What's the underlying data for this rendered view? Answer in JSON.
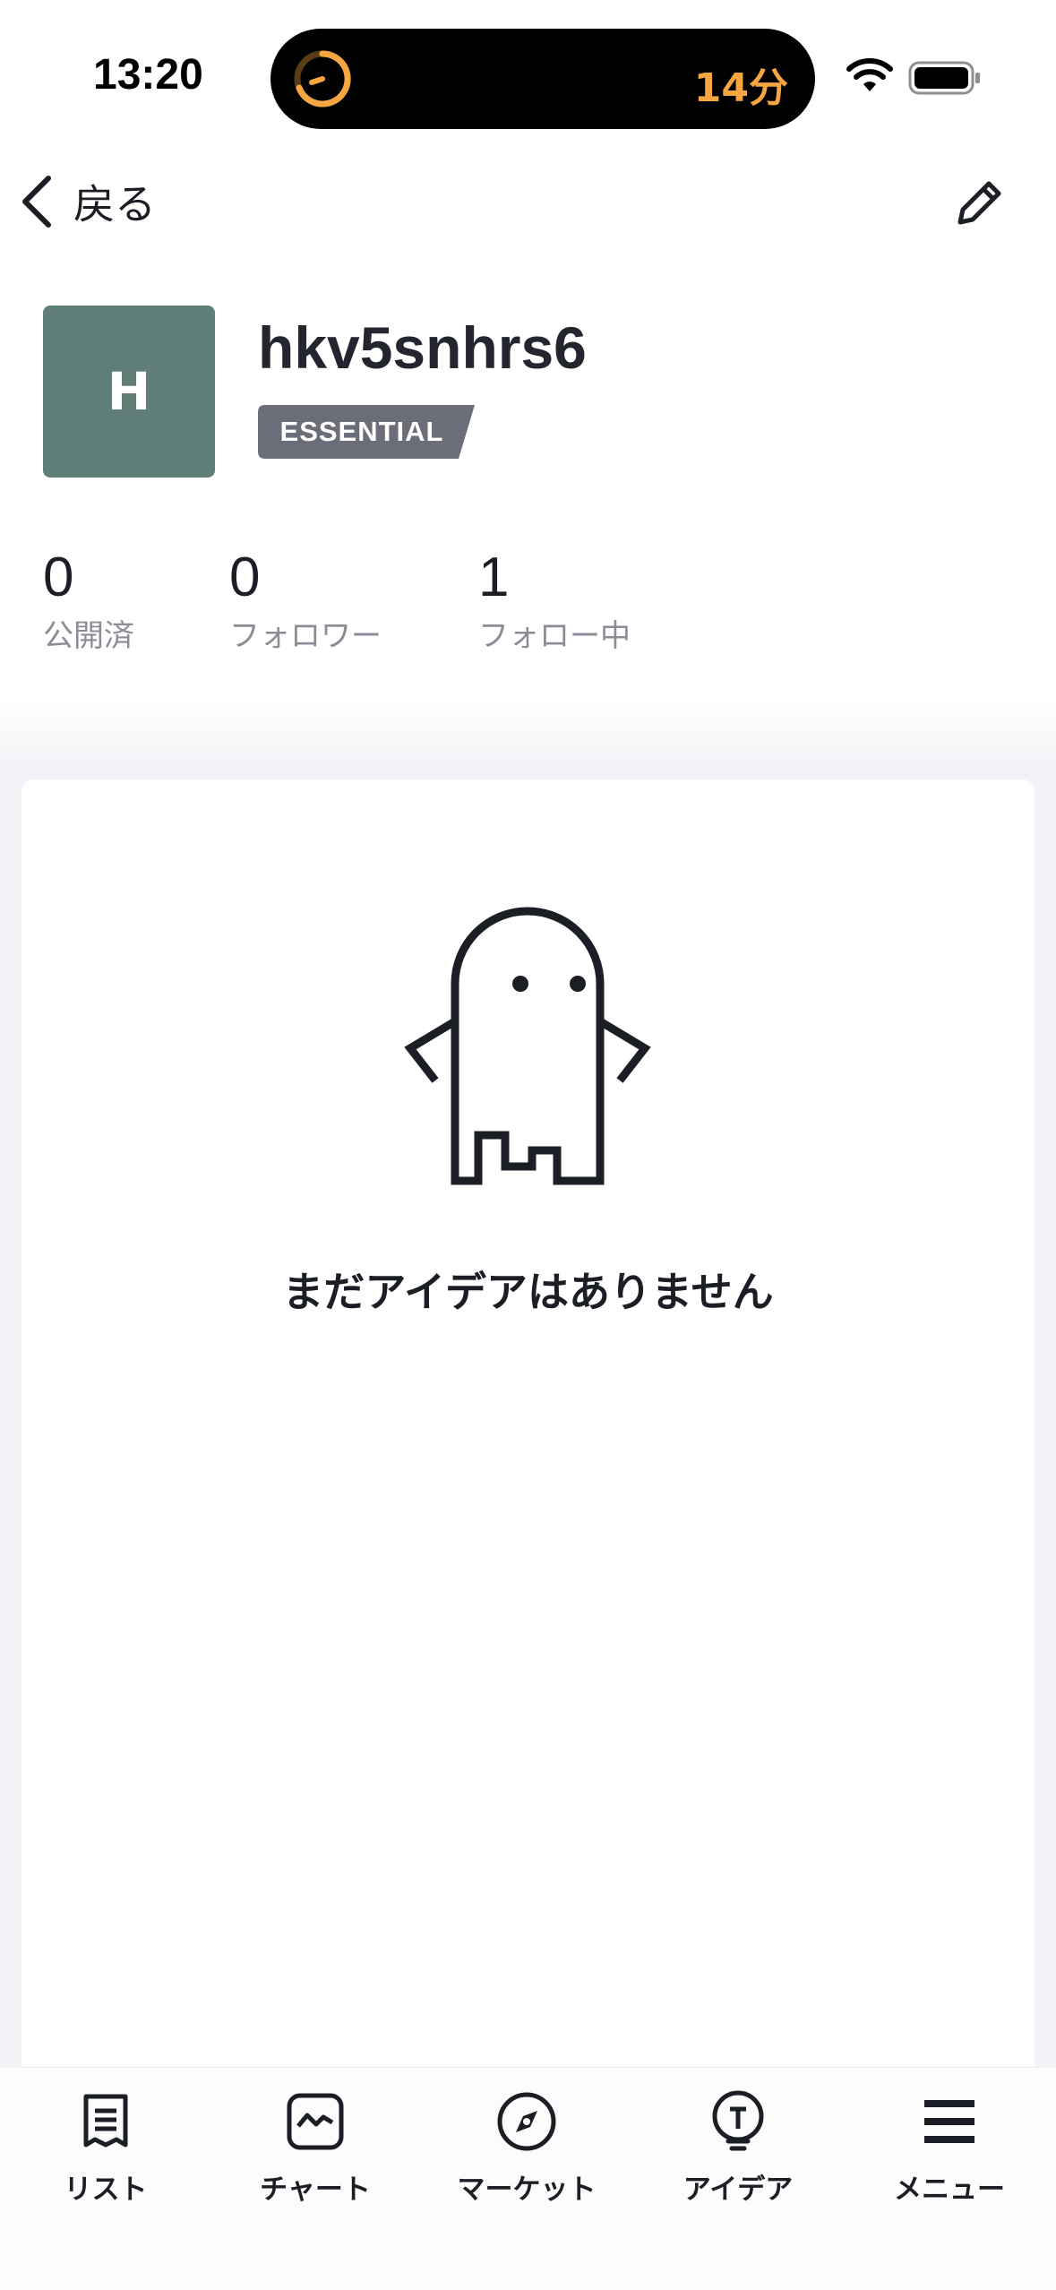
{
  "status_bar": {
    "time": "13:20",
    "island_timer": "14分",
    "accent_color": "#f5a640"
  },
  "nav": {
    "back_label": "戻る",
    "back_icon": "chevron-left-icon",
    "edit_icon": "pencil-icon"
  },
  "profile": {
    "avatar_initial": "H",
    "avatar_color": "#5f7e78",
    "username": "hkv5snhrs6",
    "plan_badge": "ESSENTIAL",
    "badge_color": "#6b6d78"
  },
  "stats": [
    {
      "value": "0",
      "label": "公開済"
    },
    {
      "value": "0",
      "label": "フォロワー"
    },
    {
      "value": "1",
      "label": "フォロー中"
    }
  ],
  "empty_state": {
    "icon": "ghost-icon",
    "message": "まだアイデアはありません"
  },
  "tabbar": [
    {
      "label": "リスト",
      "icon": "list-icon"
    },
    {
      "label": "チャート",
      "icon": "chart-icon"
    },
    {
      "label": "マーケット",
      "icon": "compass-icon"
    },
    {
      "label": "アイデア",
      "icon": "lightbulb-icon"
    },
    {
      "label": "メニュー",
      "icon": "menu-icon"
    }
  ]
}
